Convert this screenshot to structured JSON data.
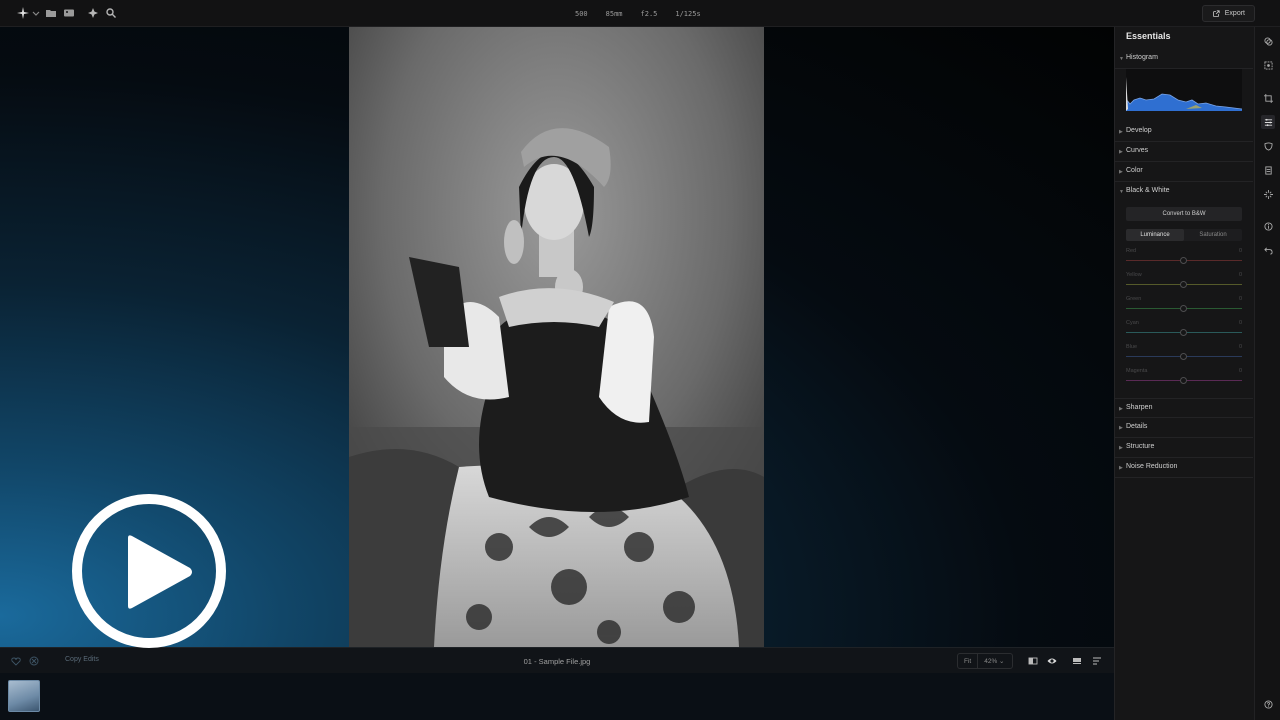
{
  "topbar": {
    "exif": [
      "500",
      "85mm",
      "f2.5",
      "1/125s"
    ],
    "export_label": "Export"
  },
  "bottombar": {
    "copy_edits": "Copy Edits",
    "filename": "01 - Sample File.jpg",
    "fit_label": "Fit",
    "zoom_value": "42% ⌄"
  },
  "panel": {
    "title": "Essentials",
    "sections_top": [
      {
        "label": "Histogram",
        "expanded": true
      },
      {
        "label": "Develop",
        "expanded": false
      },
      {
        "label": "Curves",
        "expanded": false
      },
      {
        "label": "Color",
        "expanded": false
      },
      {
        "label": "Black & White",
        "expanded": true
      }
    ],
    "bw": {
      "convert_label": "Convert to B&W",
      "tabs": [
        "Luminance",
        "Saturation"
      ],
      "active_tab": "Luminance",
      "sliders": [
        {
          "label": "Red",
          "value": "0",
          "color": "#5a2a2a"
        },
        {
          "label": "Yellow",
          "value": "0",
          "color": "#555a2a"
        },
        {
          "label": "Green",
          "value": "0",
          "color": "#2a5a33"
        },
        {
          "label": "Cyan",
          "value": "0",
          "color": "#2a5a5a"
        },
        {
          "label": "Blue",
          "value": "0",
          "color": "#2a3a5a"
        },
        {
          "label": "Magenta",
          "value": "0",
          "color": "#5a2a55"
        }
      ]
    },
    "sections_bottom": [
      {
        "label": "Sharpen"
      },
      {
        "label": "Details"
      },
      {
        "label": "Structure"
      },
      {
        "label": "Noise Reduction"
      }
    ]
  },
  "colors": {
    "histogram_fill": "#2f6fd1",
    "accent": "#1a6a9c"
  },
  "rail_icons": [
    "layers-icon",
    "select-icon",
    "crop-icon",
    "adjust-icon",
    "mask-icon",
    "presets-icon",
    "effects-icon",
    "info-icon",
    "undo-icon",
    "help-icon"
  ]
}
